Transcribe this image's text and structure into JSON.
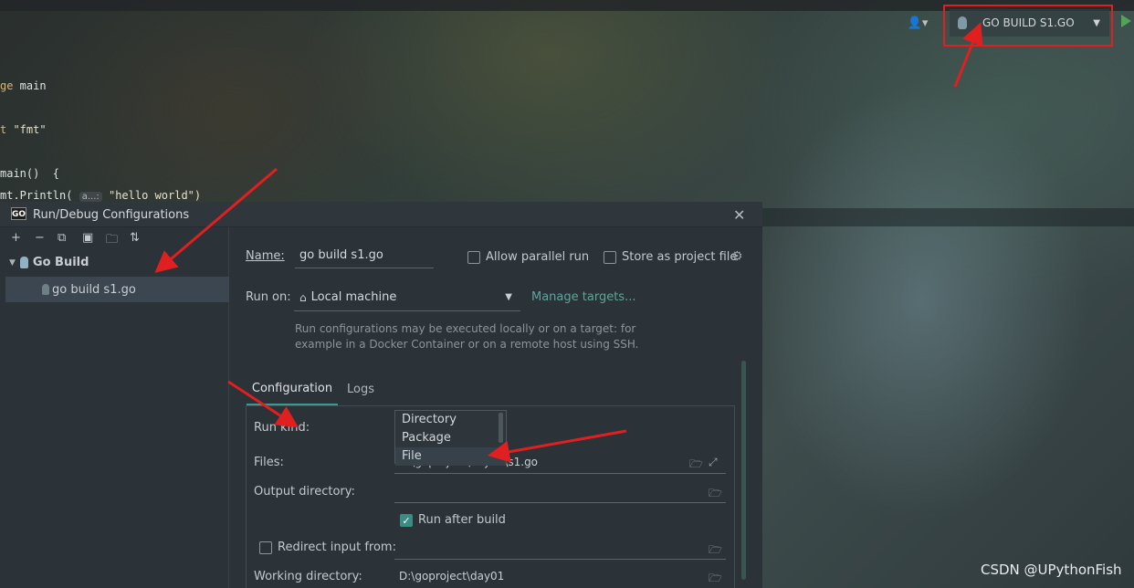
{
  "toolbar": {
    "user_icon": "user-icon",
    "run_config_label": "GO BUILD S1.GO",
    "dropdown_icon": "chevron-down-icon",
    "run_icon": "play-icon"
  },
  "editor": {
    "line1_kw": "ge",
    "line1_rest": " main",
    "line2_kw": "t",
    "line2_rest": " \"fmt\"",
    "line3": "main()  {",
    "line4_pre": "mt.Println( ",
    "line4_hint": "a...:",
    "line4_str": " \"hello world\")"
  },
  "dialog": {
    "logo": "GO",
    "title": "Run/Debug Configurations",
    "close": "✕",
    "tree": {
      "group": "Go Build",
      "item": "go build s1.go"
    },
    "name_label": "Name:",
    "name_value": "go build s1.go",
    "allow_parallel": "Allow parallel run",
    "store_project": "Store as project file",
    "run_on_label": "Run on:",
    "run_on_value": "Local machine",
    "manage_targets": "Manage targets...",
    "help_line1": "Run configurations may be executed locally or on a target: for",
    "help_line2": "example in a Docker Container or on a remote host using SSH.",
    "tabs": [
      "Configuration",
      "Logs"
    ],
    "run_kind_label": "Run kind:",
    "run_kind_options": [
      "Directory",
      "Package",
      "File"
    ],
    "files_label": "Files:",
    "files_value": "D:\\goproject\\day01\\s1.go",
    "output_dir_label": "Output directory:",
    "output_dir_value": "",
    "run_after_build": "Run after build",
    "run_after_build_checked": true,
    "redirect_input": "Redirect input from:",
    "redirect_checked": false,
    "working_dir_label": "Working directory:",
    "working_dir_value": "D:\\goproject\\day01"
  },
  "watermark": "CSDN @UPythonFish",
  "accent_colors": {
    "annotation_red": "#e02020",
    "teal": "#3e9a91",
    "link": "#5fa59a"
  }
}
